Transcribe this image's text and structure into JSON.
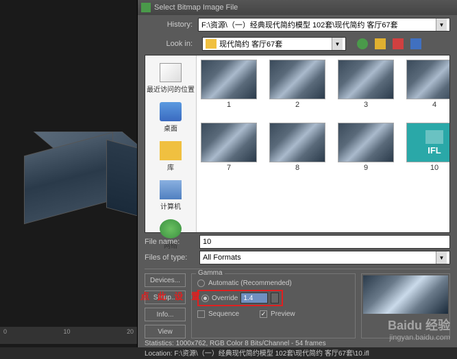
{
  "dialog": {
    "title": "Select Bitmap Image File",
    "history_label": "History:",
    "history_value": "F:\\资源\\（一）经典现代简约模型 102套\\现代简约 客厅67套",
    "lookin_label": "Look in:",
    "lookin_value": "现代简约 客厅67套"
  },
  "places": {
    "recent": "最近访问的位置",
    "desktop": "桌面",
    "library": "库",
    "computer": "计算机",
    "network": "网络"
  },
  "thumbs": {
    "t1": "1",
    "t2": "2",
    "t3": "3",
    "t4": "4",
    "t7": "7",
    "t8": "8",
    "t9": "9",
    "t10": "10",
    "ifl": "IFL"
  },
  "file": {
    "name_label": "File name:",
    "name_value": "10",
    "type_label": "Files of type:",
    "type_value": "All Formats"
  },
  "buttons": {
    "devices": "Devices...",
    "setup": "Setup...",
    "info": "Info...",
    "view": "View"
  },
  "gamma": {
    "legend": "Gamma",
    "auto": "Automatic (Recommended)",
    "override": "Override",
    "override_value": "1.4",
    "sequence": "Sequence",
    "preview": "Preview"
  },
  "annotation": "点 此 设 置",
  "stats": {
    "line1": "Statistics: 1000x762, RGB Color 8 Bits/Channel - 54 frames",
    "line2": "Location: F:\\资源\\（一）经典现代简约模型 102套\\现代简约 客厅67套\\10.ifl"
  },
  "timeline": {
    "start": "0",
    "mid": "10",
    "end": "20"
  },
  "watermark": {
    "brand": "Baidu 经验",
    "sub": "jingyan.baidu.com"
  }
}
